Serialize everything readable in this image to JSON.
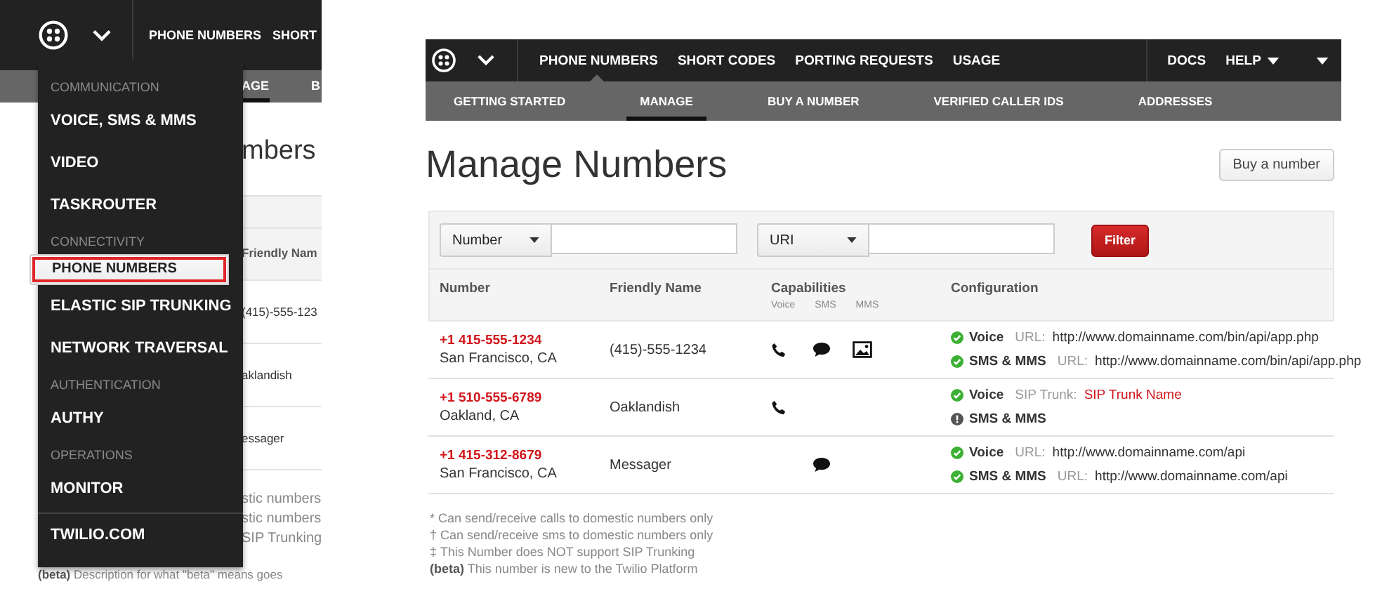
{
  "left_view": {
    "nav": [
      "PHONE NUMBERS",
      "SHORT"
    ],
    "subnav": [
      {
        "label": "AGE",
        "selected": true
      },
      {
        "label": "B",
        "selected": false
      }
    ],
    "heading": "mbers",
    "column_heading": "Friendly Nam",
    "cells": [
      "(415)-555-123",
      "aklandish",
      "essager"
    ],
    "footnotes": [
      "stic numbers",
      "stic numbers",
      "SIP Trunking"
    ],
    "beta_note": "**(beta)** Description for what \"beta\" means goes",
    "menu": {
      "sections": [
        {
          "heading": "COMMUNICATION",
          "items": [
            {
              "label": "VOICE, SMS & MMS",
              "selected": false
            },
            {
              "label": "VIDEO",
              "selected": false
            },
            {
              "label": "TASKROUTER",
              "selected": false
            }
          ]
        },
        {
          "heading": "CONNECTIVITY",
          "items": [
            {
              "label": "PHONE NUMBERS",
              "selected": true
            },
            {
              "label": "ELASTIC SIP TRUNKING",
              "selected": false
            },
            {
              "label": "NETWORK TRAVERSAL",
              "selected": false
            }
          ]
        },
        {
          "heading": "AUTHENTICATION",
          "items": [
            {
              "label": "AUTHY",
              "selected": false
            }
          ]
        },
        {
          "heading": "OPERATIONS",
          "items": [
            {
              "label": "MONITOR",
              "selected": false
            }
          ]
        }
      ],
      "footer": "TWILIO.COM"
    }
  },
  "main_view": {
    "nav": [
      {
        "label": "PHONE NUMBERS",
        "selected": true
      },
      {
        "label": "SHORT CODES",
        "selected": false
      },
      {
        "label": "PORTING REQUESTS",
        "selected": false
      },
      {
        "label": "USAGE",
        "selected": false
      }
    ],
    "nav_right": [
      {
        "label": "DOCS",
        "dropdown": false
      },
      {
        "label": "HELP",
        "dropdown": true
      }
    ],
    "subnav": [
      {
        "label": "GETTING STARTED",
        "selected": false
      },
      {
        "label": "MANAGE",
        "selected": true
      },
      {
        "label": "BUY A NUMBER",
        "selected": false
      },
      {
        "label": "VERIFIED CALLER IDS",
        "selected": false
      },
      {
        "label": "ADDRESSES",
        "selected": false
      }
    ],
    "title": "Manage Numbers",
    "buy_button": "Buy a number",
    "filters": [
      {
        "select": "Number"
      },
      {
        "select": "URI"
      }
    ],
    "filter_button": "Filter",
    "columns": [
      "Number",
      "Friendly Name",
      "Capabilities",
      "Configuration"
    ],
    "capability_labels": [
      "Voice",
      "SMS",
      "MMS"
    ],
    "rows": [
      {
        "number": "+1 415-555-1234",
        "location": "San Francisco, CA",
        "friendly_name": "(415)-555-1234",
        "voice": true,
        "sms": true,
        "mms": true,
        "config": [
          {
            "configured": true,
            "label": "Voice",
            "key": "URL:",
            "value": "http://www.domainname.com/bin/api/app.php",
            "link": false
          },
          {
            "configured": true,
            "label": "SMS & MMS",
            "key": "URL:",
            "value": "http://www.domainname.com/bin/api/app.php",
            "link": false
          }
        ]
      },
      {
        "number": "+1 510-555-6789",
        "location": "Oakland, CA",
        "friendly_name": "Oaklandish",
        "voice": true,
        "sms": false,
        "mms": false,
        "config": [
          {
            "configured": true,
            "label": "Voice",
            "key": "SIP Trunk:",
            "value": "SIP Trunk Name",
            "link": true
          },
          {
            "configured": false,
            "label": "SMS & MMS"
          }
        ]
      },
      {
        "number": "+1 415-312-8679",
        "location": "San Francisco, CA",
        "friendly_name": "Messager",
        "voice": false,
        "sms": true,
        "mms": false,
        "config": [
          {
            "configured": true,
            "label": "Voice",
            "key": "URL:",
            "value": "http://www.domainname.com/api",
            "link": false
          },
          {
            "configured": true,
            "label": "SMS & MMS",
            "key": "URL:",
            "value": "http://www.domainname.com/api",
            "link": false
          }
        ]
      }
    ],
    "footnotes": [
      "* Can send/receive calls to domestic numbers only",
      "† Can send/receive sms to domestic numbers only",
      "‡ This Number does NOT support SIP Trunking",
      "**(beta)** This number is new to the Twilio Platform"
    ]
  }
}
